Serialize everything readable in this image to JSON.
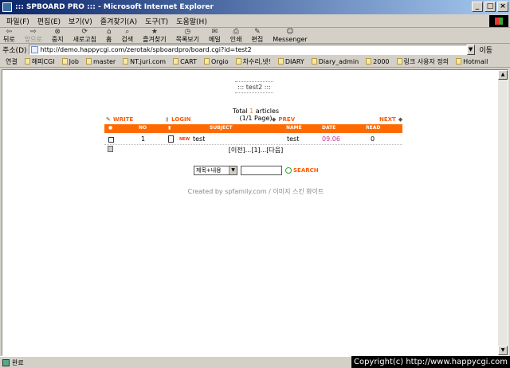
{
  "window": {
    "title": "::: SPBOARD PRO ::: - Microsoft Internet Explorer",
    "minimize": "_",
    "maximize": "□",
    "close": "×"
  },
  "menu": [
    "파일(F)",
    "편집(E)",
    "보기(V)",
    "즐겨찾기(A)",
    "도구(T)",
    "도움말(H)"
  ],
  "toolbar": [
    {
      "label": "뒤로",
      "icon": "back-icon",
      "glyph": "⇦"
    },
    {
      "label": "앞으로",
      "icon": "forward-icon",
      "glyph": "⇨"
    },
    {
      "label": "중지",
      "icon": "stop-icon",
      "glyph": "⊗"
    },
    {
      "label": "새로고침",
      "icon": "refresh-icon",
      "glyph": "⟳"
    },
    {
      "label": "홈",
      "icon": "home-icon",
      "glyph": "⌂"
    },
    {
      "label": "검색",
      "icon": "search-icon",
      "glyph": "⌕"
    },
    {
      "label": "즐겨찾기",
      "icon": "favorites-icon",
      "glyph": "★"
    },
    {
      "label": "목록보기",
      "icon": "history-icon",
      "glyph": "◷"
    },
    {
      "label": "메일",
      "icon": "mail-icon",
      "glyph": "✉"
    },
    {
      "label": "인쇄",
      "icon": "print-icon",
      "glyph": "⎙"
    },
    {
      "label": "편집",
      "icon": "edit-icon",
      "glyph": "✎"
    },
    {
      "label": "Messenger",
      "icon": "messenger-icon",
      "glyph": "☺"
    }
  ],
  "address": {
    "label": "주소(D)",
    "url": "http://demo.happycgi.com/zerotak/spboardpro/board.cgi?id=test2",
    "go": "이동"
  },
  "links": {
    "label": "연결",
    "items": [
      "해피CGI",
      "Job",
      "master",
      "NT.juri.com",
      "CART",
      "Orgio",
      "차수리,넷!",
      "DIARY",
      "Diary_admin",
      "2000",
      "링크 사용자 정의",
      "Hotmail"
    ]
  },
  "board": {
    "title": "::: test2 :::",
    "total_prefix": "Total",
    "total_count": "1",
    "total_suffix": "articles",
    "page_info": "(1/1 Page)",
    "actions": {
      "write": "WRITE",
      "login": "LOGIN",
      "prev": "PREV",
      "next": "NEXT"
    },
    "columns": {
      "no": "NO",
      "subject": "SUBJECT",
      "name": "NAME",
      "date": "DATE",
      "read": "READ"
    },
    "rows": [
      {
        "no": "1",
        "new": "NEW",
        "subject": "test",
        "name": "test",
        "date": "09.06",
        "read": "0"
      }
    ],
    "paging": "[이전]...[1]...[다음]",
    "search": {
      "select": "제목+내용",
      "button": "SEARCH"
    },
    "credit": "Created by spfamily.com / 이미지 스킨 화이트"
  },
  "status": {
    "text": "완료"
  },
  "copyright": "Copyright(c) http://www.happycgi.com"
}
